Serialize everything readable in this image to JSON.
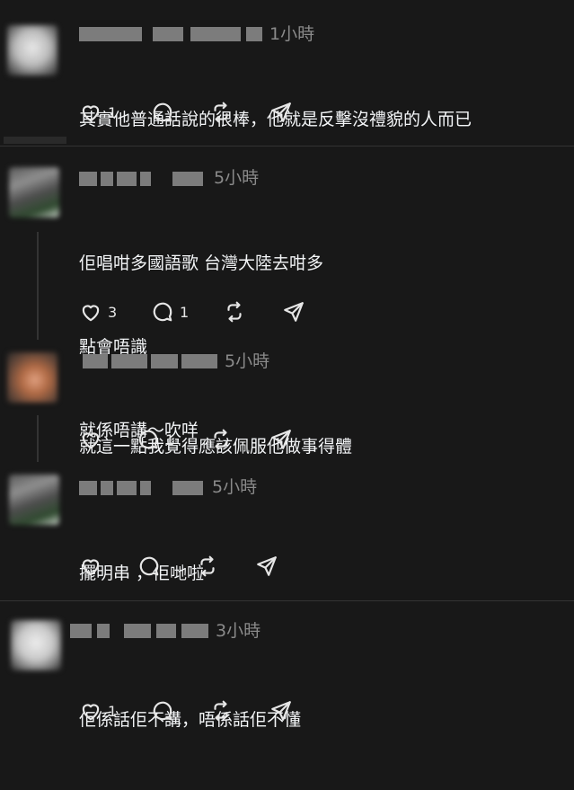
{
  "comments": [
    {
      "time": "1小時",
      "lines": [
        "其實他普通話說的很棒，他就是反擊沒禮貌的人而已"
      ],
      "likes": "1",
      "replies": ""
    },
    {
      "time": "5小時",
      "lines": [
        "佢唱咁多國語歌 台灣大陸去咁多",
        "點會唔識",
        "就係唔講～吹咩"
      ],
      "likes": "3",
      "replies": "1"
    },
    {
      "time": "5小時",
      "lines": [
        "就這一點我覺得應該佩服他做事得體"
      ],
      "likes": "",
      "replies": "1"
    },
    {
      "time": "5小時",
      "lines": [
        "擺明串 ，佢哋啦"
      ],
      "likes": "",
      "replies": ""
    },
    {
      "time": "3小時",
      "lines": [
        "佢係話佢不講，唔係話佢不懂"
      ],
      "likes": "1",
      "replies": ""
    }
  ],
  "icons": {
    "like": "heart-icon",
    "reply": "comment-icon",
    "repost": "repost-icon",
    "share": "send-icon"
  },
  "colors": {
    "background": "#181818",
    "text": "#f3f5f7",
    "muted": "#8a8a8a",
    "divider": "#333333"
  }
}
